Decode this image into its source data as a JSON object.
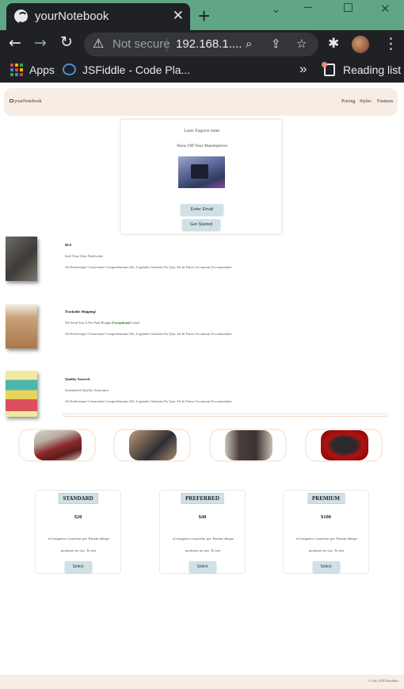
{
  "browser": {
    "tab_title": "yourNotebook",
    "tab_close": "✕",
    "new_tab": "+",
    "omnibox": {
      "security": "Not secure",
      "url": "192.168.1...."
    },
    "bookmarks": [
      {
        "label": "Apps",
        "icon": "apps-grid-icon"
      },
      {
        "label": "JSFiddle - Code Pla...",
        "icon": "jsfiddle-icon"
      }
    ],
    "bookmarks_overflow": "»",
    "reading_list": "Reading list",
    "colors": {
      "titlebar": "#60a685",
      "toolbar": "#202124"
    }
  },
  "site": {
    "brand": "yourNotebook",
    "nav": [
      "Pricing",
      "Styles",
      "Features"
    ],
    "hero": {
      "line1": "Laser Engrave notes",
      "line2": "Show Off Your Masterpieces",
      "email_button": "Enter Email",
      "cta_button": "Get Started"
    },
    "features": [
      {
        "title": "$9.0",
        "subtitle": "Seal Your Own Notebooks",
        "body": "Ad Scelerisque Consectetur Comprehensum Alii, Legendos Solamen Ex Quo. Sit In Tuitor Accumsan Accommodare"
      },
      {
        "title": "Trackable Shipping!",
        "subtitle_pre": "We Send You A Pre Paid Bought",
        "subtitle_highlight": "Exceptional",
        "subtitle_post": "Label",
        "body": "Ad Scelerisque Consectetur Comprehensum Alii, Legendos Solamen Ex Quo. Sit In Tuitor Accumsan Accommodare"
      },
      {
        "title": "Quality Assured",
        "subtitle": "Guaranteed Quality Assurance",
        "body": "Ad Scelerisque Consectetur Comprehensum Alii, Legendos Solamen Ex Quo. Sit In Tuitor Accumsan Accommodare"
      }
    ],
    "pricing": [
      {
        "tier": "STANDARD",
        "price": "$20",
        "desc1": "id eusquetur consetetur per. Partem tibique",
        "desc2": "prodesset no usu. Te mei.",
        "button": "Select"
      },
      {
        "tier": "PREFERRED",
        "price": "$40",
        "desc1": "id eusquetur consetetur per. Partem tibique",
        "desc2": "prodesset no usu. Te mei.",
        "button": "Select"
      },
      {
        "tier": "PREMIUM",
        "price": "$100",
        "desc1": "id eusquetur consetetur per. Partem tibique",
        "desc2": "prodesset no usu. Te mei.",
        "button": "Select"
      }
    ],
    "footer": "© 2by DATAbuddies",
    "colors": {
      "accent_bg": "#f8ede4",
      "button_bg": "#cfe1e6",
      "highlight": "#1a7f2e"
    }
  }
}
